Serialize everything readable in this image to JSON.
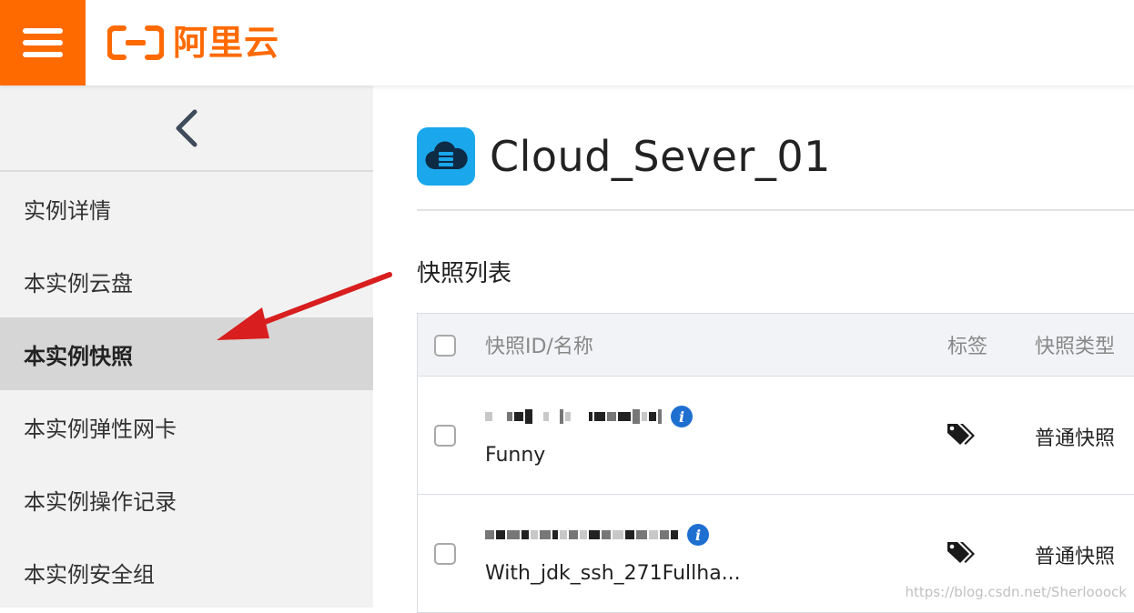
{
  "brand": {
    "name": "阿里云",
    "color": "#ff6a00"
  },
  "sidebar": {
    "items": [
      {
        "label": "实例详情"
      },
      {
        "label": "本实例云盘"
      },
      {
        "label": "本实例快照"
      },
      {
        "label": "本实例弹性网卡"
      },
      {
        "label": "本实例操作记录"
      },
      {
        "label": "本实例安全组"
      }
    ],
    "active_index": 2
  },
  "main": {
    "title": "Cloud_Sever_01",
    "section_title": "快照列表",
    "table": {
      "headers": {
        "id_name": "快照ID/名称",
        "tags": "标签",
        "type": "快照类型"
      },
      "rows": [
        {
          "name": "Funny",
          "type": "普通快照"
        },
        {
          "name": "With_jdk_ssh_271Fullha...",
          "type": "普通快照"
        }
      ]
    }
  },
  "icons": {
    "menu": "hamburger-menu-icon",
    "collapse": "chevron-left-icon",
    "instance": "cloud-server-icon",
    "info": "info-icon",
    "tag": "tags-icon"
  },
  "annotation": {
    "arrow_color": "#d81e1e"
  },
  "watermark": "https://blog.csdn.net/Sherlooock"
}
